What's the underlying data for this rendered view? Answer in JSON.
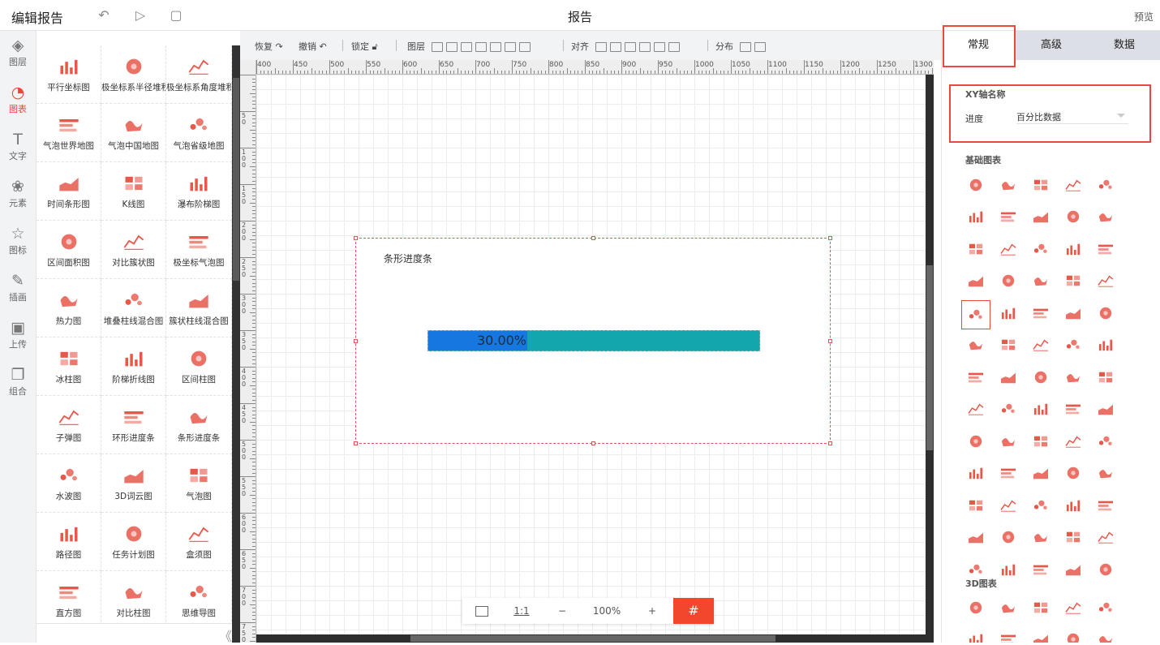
{
  "header": {
    "app_title": "编辑报告",
    "doc_title": "报告",
    "preview_label": "预览"
  },
  "leftnav": [
    {
      "label": "图层",
      "icon": "layers-icon",
      "glyph": "◈"
    },
    {
      "label": "图表",
      "icon": "chart-icon",
      "glyph": "◔",
      "active": true
    },
    {
      "label": "文字",
      "icon": "text-icon",
      "glyph": "T"
    },
    {
      "label": "元素",
      "icon": "elements-icon",
      "glyph": "❀"
    },
    {
      "label": "图标",
      "icon": "star-icon",
      "glyph": "☆"
    },
    {
      "label": "插画",
      "icon": "palette-icon",
      "glyph": "✎"
    },
    {
      "label": "上传",
      "icon": "image-icon",
      "glyph": "▣"
    },
    {
      "label": "组合",
      "icon": "group-icon",
      "glyph": "❐"
    }
  ],
  "palette": [
    {
      "label": "平行坐标图",
      "icon": "parallel-coords-icon"
    },
    {
      "label": "极坐标系半径堆积",
      "icon": "polar-radius-icon"
    },
    {
      "label": "极坐标系角度堆积",
      "icon": "polar-angle-icon"
    },
    {
      "label": "气泡世界地图",
      "icon": "world-map-icon"
    },
    {
      "label": "气泡中国地图",
      "icon": "china-map-icon"
    },
    {
      "label": "气泡省级地图",
      "icon": "province-map-icon"
    },
    {
      "label": "时间条形图",
      "icon": "time-bar-icon"
    },
    {
      "label": "K线图",
      "icon": "candlestick-icon"
    },
    {
      "label": "瀑布阶梯图",
      "icon": "waterfall-icon"
    },
    {
      "label": "区间面积图",
      "icon": "range-area-icon"
    },
    {
      "label": "对比簇状图",
      "icon": "compare-cluster-icon"
    },
    {
      "label": "极坐标气泡图",
      "icon": "polar-bubble-icon"
    },
    {
      "label": "热力图",
      "icon": "heatmap-icon"
    },
    {
      "label": "堆叠柱线混合图",
      "icon": "stacked-bar-line-icon"
    },
    {
      "label": "簇状柱线混合图",
      "icon": "cluster-bar-line-icon"
    },
    {
      "label": "冰柱图",
      "icon": "icicle-icon"
    },
    {
      "label": "阶梯折线图",
      "icon": "step-line-icon"
    },
    {
      "label": "区间柱图",
      "icon": "range-bar-icon"
    },
    {
      "label": "子弹图",
      "icon": "bullet-icon"
    },
    {
      "label": "环形进度条",
      "icon": "ring-progress-icon"
    },
    {
      "label": "条形进度条",
      "icon": "bar-progress-icon"
    },
    {
      "label": "水波图",
      "icon": "liquid-icon"
    },
    {
      "label": "3D词云图",
      "icon": "wordcloud-icon"
    },
    {
      "label": "气泡图",
      "icon": "bubble-icon"
    },
    {
      "label": "路径图",
      "icon": "path-icon"
    },
    {
      "label": "任务计划图",
      "icon": "gantt-icon"
    },
    {
      "label": "盒须图",
      "icon": "boxplot-icon"
    },
    {
      "label": "直方图",
      "icon": "histogram-icon"
    },
    {
      "label": "对比柱图",
      "icon": "compare-bar-icon"
    },
    {
      "label": "思维导图",
      "icon": "mindmap-icon"
    }
  ],
  "toolbar": {
    "restore": "恢复",
    "undo": "撤销",
    "lock": "锁定",
    "layer": "图层",
    "align": "对齐",
    "distribute": "分布"
  },
  "ruler": {
    "h_ticks": [
      "400",
      "450",
      "500",
      "550",
      "600",
      "650",
      "700",
      "750",
      "800",
      "850",
      "900",
      "950",
      "1000",
      "1050",
      "1100",
      "1150",
      "1200",
      "1250",
      "1300"
    ],
    "v_ticks": [
      "",
      "50",
      "100",
      "150",
      "200",
      "250",
      "300",
      "350",
      "400",
      "450",
      "500",
      "550",
      "600",
      "650",
      "700",
      "750"
    ]
  },
  "widget": {
    "title": "条形进度条",
    "progress": 0.3,
    "progress_label": "30.00%",
    "fill_color": "#1677e0",
    "track_color": "#13a6ad"
  },
  "zoom": {
    "ratio_label": "1:1",
    "minus": "−",
    "level": "100%",
    "plus": "+",
    "grid": "#"
  },
  "right_panel": {
    "tabs": [
      "常规",
      "高级",
      "数据"
    ],
    "axis_section_title": "XY轴名称",
    "progress_label": "进度",
    "progress_value": "百分比数据",
    "basic_section_title": "基础图表",
    "basic_count": 65,
    "selected_index": 20,
    "three_d_section_title": "3D图表",
    "three_d_count": 10
  },
  "colors": {
    "accent": "#e8493c",
    "chart_icon": "#e8574a"
  }
}
